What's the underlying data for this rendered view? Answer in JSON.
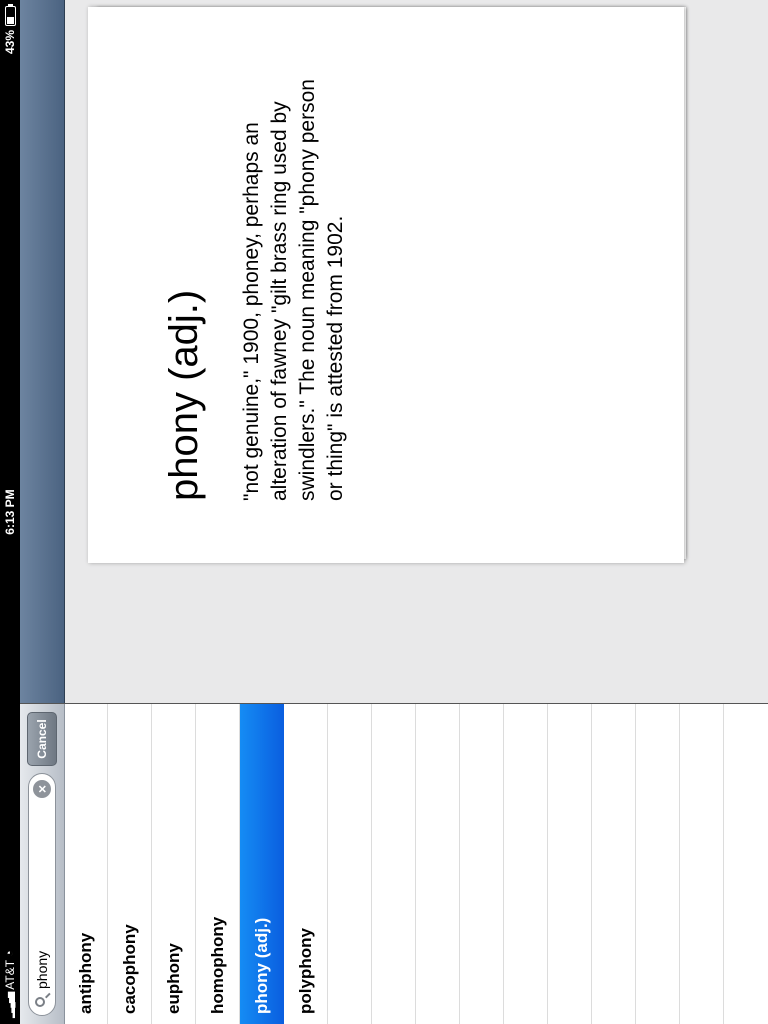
{
  "status_bar": {
    "carrier": "AT&T",
    "time": "6:13 PM",
    "battery_percent": "43%",
    "battery_level": 0.43
  },
  "search": {
    "query": "phony",
    "cancel_label": "Cancel"
  },
  "word_list": [
    {
      "label": "antiphony"
    },
    {
      "label": "cacophony"
    },
    {
      "label": "euphony"
    },
    {
      "label": "homophony"
    },
    {
      "label": "phony (adj.)",
      "selected": true
    },
    {
      "label": "polyphony"
    }
  ],
  "entry": {
    "title": "phony (adj.)",
    "definition": "\"not genuine,\" 1900, phoney, perhaps an alteration of fawney \"gilt brass ring used by swindlers.\" The noun meaning \"phony person or thing\" is attested from 1902."
  },
  "colors": {
    "selection": "#0a6ff0",
    "navbar": "#4b6381"
  }
}
